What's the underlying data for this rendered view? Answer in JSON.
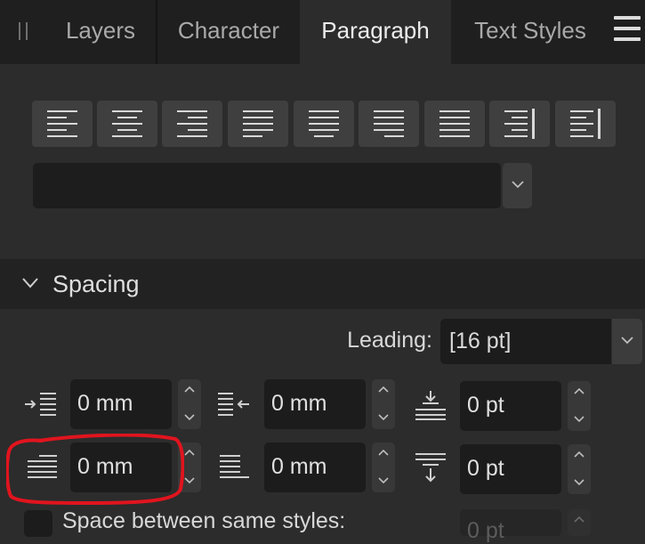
{
  "tabs": [
    "Layers",
    "Character",
    "Paragraph",
    "Text Styles"
  ],
  "active_tab": "Paragraph",
  "alignment": {
    "buttons": [
      "align-left",
      "align-center",
      "align-right",
      "justify-left",
      "justify-center",
      "justify-right",
      "justify-all",
      "align-toward-spine",
      "align-away-from-spine"
    ]
  },
  "style_dropdown": {
    "value": ""
  },
  "spacing": {
    "title": "Spacing",
    "leading_label": "Leading:",
    "leading_value": "[16 pt]",
    "left_indent": "0 mm",
    "right_indent": "0 mm",
    "space_before": "0 pt",
    "first_line_indent": "0 mm",
    "last_line_indent": "0 mm",
    "space_after": "0 pt",
    "space_between_label": "Space between same styles:",
    "space_between_value": "0 pt"
  },
  "annotation": {
    "color": "#e0141e"
  }
}
